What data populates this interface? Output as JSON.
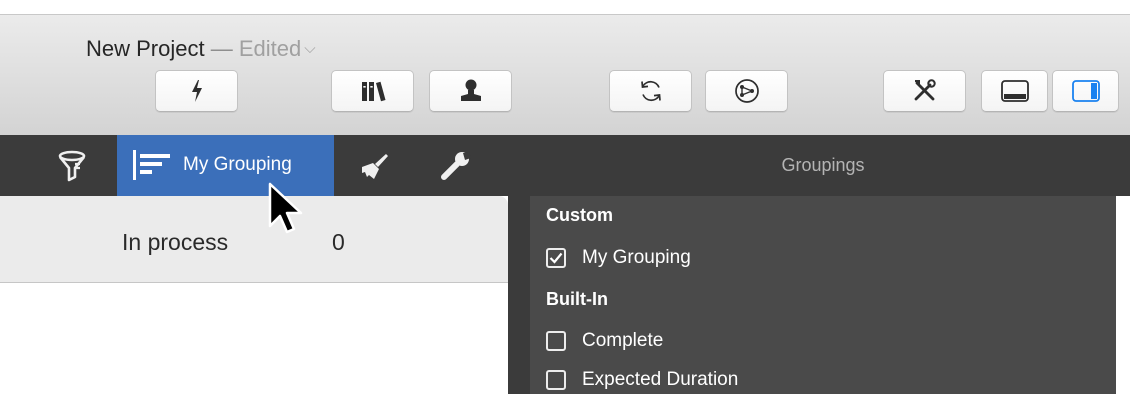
{
  "window": {
    "title": "New Project",
    "dash": "—",
    "edited": "Edited"
  },
  "toolbar": {
    "buttons": [
      {
        "name": "lightning-icon"
      },
      {
        "name": "library-icon"
      },
      {
        "name": "person-icon"
      },
      {
        "name": "refresh-icon"
      },
      {
        "name": "share-icon"
      },
      {
        "name": "tools-icon"
      },
      {
        "name": "bottom-panel-icon"
      },
      {
        "name": "right-panel-icon",
        "active": true
      }
    ]
  },
  "tabs": {
    "active_label": "My Grouping",
    "icons": [
      "filter-icon",
      "grouping-icon",
      "brush-icon",
      "wrench-icon"
    ]
  },
  "content": {
    "group_label": "In process",
    "group_count": "0"
  },
  "groupings": {
    "title": "Groupings",
    "custom_header": "Custom",
    "custom_items": [
      {
        "label": "My Grouping",
        "checked": true
      }
    ],
    "builtin_header": "Built-In",
    "builtin_items": [
      {
        "label": "Complete",
        "checked": false
      },
      {
        "label": "Expected Duration",
        "checked": false
      }
    ]
  },
  "colors": {
    "accent": "#3b6fba",
    "toolbar_dark": "#3b3b3b",
    "panel": "#4a4a4a",
    "active_toggle": "#1a82f0"
  }
}
